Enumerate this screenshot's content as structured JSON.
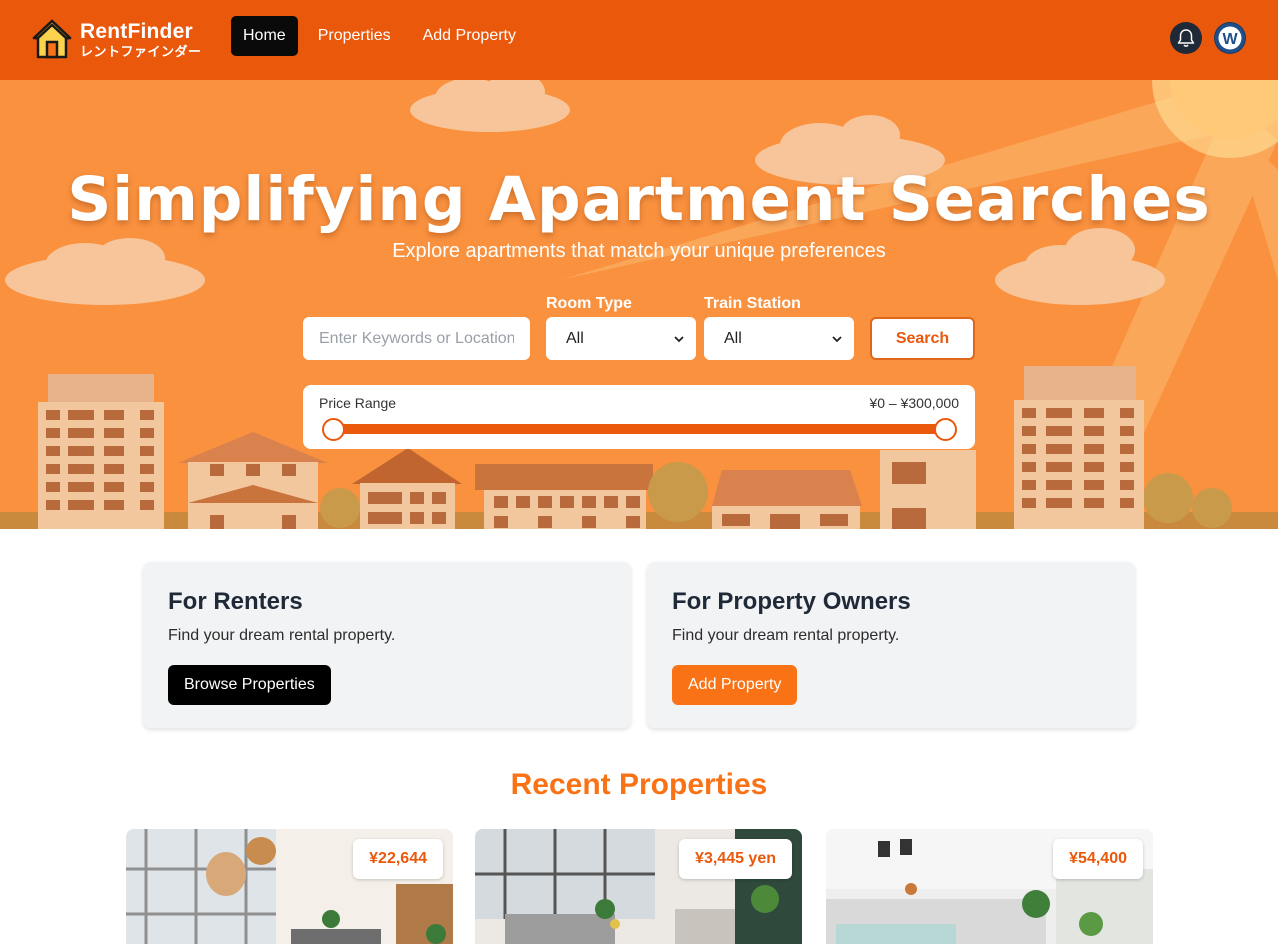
{
  "brand": {
    "name": "RentFinder",
    "subtitle": "レントファインダー"
  },
  "nav": {
    "links": [
      {
        "label": "Home",
        "active": true
      },
      {
        "label": "Properties",
        "active": false
      },
      {
        "label": "Add Property",
        "active": false
      }
    ],
    "notifications_icon": "bell-icon",
    "avatar_initial": "W"
  },
  "hero": {
    "title": "Simplifying Apartment Searches",
    "subtitle": "Explore apartments that match your unique preferences",
    "search": {
      "keyword_placeholder": "Enter Keywords or Location",
      "room_type_label": "Room Type",
      "room_type_value": "All",
      "train_station_label": "Train Station",
      "train_station_value": "All",
      "search_button": "Search"
    },
    "price": {
      "label": "Price Range",
      "value_text": "¥0 – ¥300,000",
      "min_fraction": 0,
      "max_fraction": 1
    }
  },
  "cards": [
    {
      "title": "For Renters",
      "text": "Find your dream rental property.",
      "button": "Browse Properties"
    },
    {
      "title": "For Property Owners",
      "text": "Find your dream rental property.",
      "button": "Add Property"
    }
  ],
  "recent": {
    "title": "Recent Properties",
    "properties": [
      {
        "price": "¥22,644"
      },
      {
        "price": "¥3,445 yen"
      },
      {
        "price": "¥54,400"
      }
    ]
  },
  "colors": {
    "primary": "#ea580c",
    "hero_bg": "#f9913f",
    "accent": "#f97316",
    "dark": "#000000"
  }
}
